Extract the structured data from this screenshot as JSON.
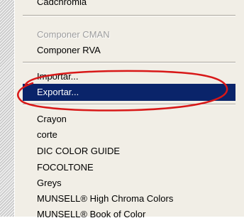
{
  "menu": {
    "items": [
      {
        "label": "Cadchromia"
      },
      {
        "label": "Componer CMAN",
        "disabled": true
      },
      {
        "label": "Componer RVA"
      },
      {
        "label": "Importar..."
      },
      {
        "label": "Exportar...",
        "selected": true
      },
      {
        "label": "Crayon"
      },
      {
        "label": "corte"
      },
      {
        "label": "DIC COLOR GUIDE"
      },
      {
        "label": "FOCOLTONE"
      },
      {
        "label": "Greys"
      },
      {
        "label": "MUNSELL® High Chroma Colors"
      },
      {
        "label": "MUNSELL® Book of Color"
      }
    ]
  },
  "annotation": {
    "color": "#d81818"
  }
}
